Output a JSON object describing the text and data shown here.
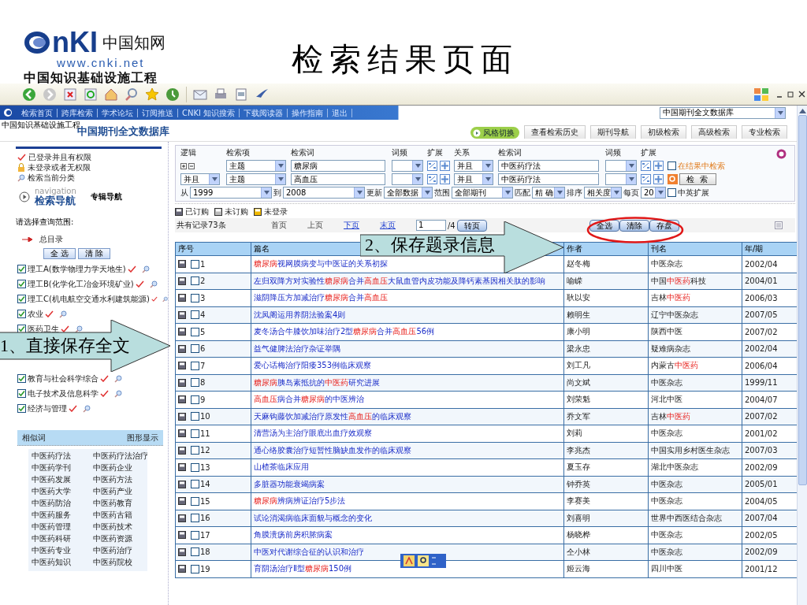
{
  "slide": {
    "title": "检索结果页面",
    "logo": {
      "mark": "nKI",
      "name": "中国知网",
      "url": "www.cnki.net",
      "tagline": "中国知识基础设施工程"
    }
  },
  "site": {
    "logo_tagline": "中国知识基础设施工程",
    "nav": [
      "检索首页",
      "跨库检索",
      "学术论坛",
      "订阅推送",
      "CNKI 知识搜索",
      "下载阅读器",
      "操作指南",
      "退出"
    ],
    "database_select": "中国期刊全文数据库",
    "heading": "中国期刊全文数据库",
    "style_switch": "风格切换",
    "tabs": [
      {
        "label": "查看检索历史",
        "selected": false
      },
      {
        "label": "期刊导航",
        "selected": false
      },
      {
        "label": "初级检索",
        "selected": false
      },
      {
        "label": "高级检索",
        "selected": false
      },
      {
        "label": "专业检索",
        "selected": false
      }
    ]
  },
  "status_legend": [
    {
      "kind": "ok",
      "label": "已登录并且有权限"
    },
    {
      "kind": "lock",
      "label": "未登录或者无权限"
    },
    {
      "kind": "search",
      "label": "检索当前分类"
    }
  ],
  "navigation": {
    "hint": "navigation",
    "label": "检索导航",
    "alt": "专辑导航"
  },
  "scope": {
    "prompt": "请选择查询范围:",
    "root": "总目录",
    "buttons": [
      "全 选",
      "清 除"
    ],
    "categories": [
      {
        "label": "理工A(数学物理力学天地生)",
        "checked": true
      },
      {
        "label": "理工B(化学化工冶金环境矿业)",
        "checked": true
      },
      {
        "label": "理工C(机电航空交通水利建筑能源)",
        "checked": true
      },
      {
        "label": "农业",
        "checked": true
      },
      {
        "label": "医药卫生",
        "checked": true
      },
      {
        "label": "教育与社会科学综合",
        "checked": true
      },
      {
        "label": "电子技术及信息科学",
        "checked": true
      },
      {
        "label": "经济与管理",
        "checked": true
      }
    ]
  },
  "similar": {
    "title": "相似词",
    "action": "图形显示",
    "words": [
      "中医药疗法",
      "中医药疗法治疗",
      "中医药学刊",
      "中医药企业",
      "中医药发展",
      "中医药方法",
      "中医药大学",
      "中医药产业",
      "中医药防治",
      "中医药教育",
      "中医药服务",
      "中医药古籍",
      "中医药管理",
      "中医药技术",
      "中医药科研",
      "中医药资源",
      "中医药专业",
      "中医药治疗",
      "中医药知识",
      "中医药院校"
    ]
  },
  "search": {
    "headers": [
      "逻辑",
      "检索项",
      "检索词",
      "词频",
      "扩展",
      "关系",
      "检索词",
      "词频",
      "扩展"
    ],
    "rows": [
      {
        "field": "主题",
        "term": "糖尿病",
        "relation": "并且",
        "term2": "中医药疗法"
      },
      {
        "logic": "并且",
        "field": "主题",
        "term": "高血压",
        "relation": "并且",
        "term2": "中医药疗法"
      }
    ],
    "options": [
      {
        "label": "从",
        "value": "1999"
      },
      {
        "label": "到",
        "value": "2008"
      },
      {
        "label": "更新",
        "value": "全部数据"
      },
      {
        "label": "范围",
        "value": "全部期刊"
      },
      {
        "label": "匹配",
        "value": "精 确"
      },
      {
        "label": "排序",
        "value": "相关度"
      },
      {
        "label": "每页",
        "value": "20"
      }
    ],
    "bilingual": {
      "label": "中英扩展",
      "checked": false
    },
    "within_results": {
      "label": "在结果中检索",
      "checked": false
    },
    "submit": "检 索"
  },
  "access_legend": [
    {
      "kind": "ordered",
      "label": "已订购"
    },
    {
      "kind": "unordered",
      "label": "未订购"
    },
    {
      "kind": "guest",
      "label": "未登录"
    }
  ],
  "pager": {
    "total": "共有记录73条",
    "links": [
      {
        "label": "首页",
        "enabled": false
      },
      {
        "label": "上页",
        "enabled": false
      },
      {
        "label": "下页",
        "enabled": true
      },
      {
        "label": "末页",
        "enabled": true
      }
    ],
    "page": "1",
    "of": "/4",
    "go": "转页"
  },
  "actions": [
    "全选",
    "清除",
    "存盘"
  ],
  "table": {
    "columns": [
      "序号",
      "篇名",
      "作者",
      "刊名",
      "年/期"
    ],
    "rows": [
      {
        "no": "1",
        "checked": false,
        "title": [
          {
            "text": "糖尿病",
            "hl": true
          },
          {
            "text": "视网膜病变与中医证的关系初探",
            "hl": false
          }
        ],
        "author": "赵冬梅",
        "journal": [
          {
            "text": "中医杂志",
            "hl": false
          }
        ],
        "issue": "2002/04"
      },
      {
        "no": "2",
        "checked": false,
        "title": [
          {
            "text": "左归双降方对实验性",
            "hl": false
          },
          {
            "text": "糖尿病",
            "hl": true
          },
          {
            "text": "合并",
            "hl": false
          },
          {
            "text": "高血压",
            "hl": true
          },
          {
            "text": "大鼠血管内皮功能及降钙素基因相关肽的影响",
            "hl": false
          }
        ],
        "author": "喻嵘",
        "journal": [
          {
            "text": "中国",
            "hl": false
          },
          {
            "text": "中医药",
            "hl": true
          },
          {
            "text": "科技",
            "hl": false
          }
        ],
        "issue": "2004/01"
      },
      {
        "no": "3",
        "checked": false,
        "title": [
          {
            "text": "滋阴降压方加减治疗",
            "hl": false
          },
          {
            "text": "糖尿病",
            "hl": true
          },
          {
            "text": "合并",
            "hl": false
          },
          {
            "text": "高血压",
            "hl": true
          }
        ],
        "author": "耿以安",
        "journal": [
          {
            "text": "吉林",
            "hl": false
          },
          {
            "text": "中医药",
            "hl": true
          }
        ],
        "issue": "2006/03"
      },
      {
        "no": "4",
        "checked": false,
        "title": [
          {
            "text": "沈凤阁运用养阴法验案4则",
            "hl": false
          }
        ],
        "author": "赖明生",
        "journal": [
          {
            "text": "辽宁中医杂志",
            "hl": false
          }
        ],
        "issue": "2007/05"
      },
      {
        "no": "5",
        "checked": false,
        "title": [
          {
            "text": "麦冬汤合牛膝饮加味治疗2型",
            "hl": false
          },
          {
            "text": "糖尿病",
            "hl": true
          },
          {
            "text": "合并",
            "hl": false
          },
          {
            "text": "高血压",
            "hl": true
          },
          {
            "text": "56例",
            "hl": false
          }
        ],
        "author": "康小明",
        "journal": [
          {
            "text": "陕西中医",
            "hl": false
          }
        ],
        "issue": "2007/02"
      },
      {
        "no": "6",
        "checked": false,
        "title": [
          {
            "text": "益气健脾法治疗杂证举隅",
            "hl": false
          }
        ],
        "author": "梁永忠",
        "journal": [
          {
            "text": "疑难病杂志",
            "hl": false
          }
        ],
        "issue": "2002/04"
      },
      {
        "no": "7",
        "checked": false,
        "title": [
          {
            "text": "爱心话梅治疗阳痿353例临床观察",
            "hl": false
          }
        ],
        "author": "刘工凡",
        "journal": [
          {
            "text": "内蒙古",
            "hl": false
          },
          {
            "text": "中医药",
            "hl": true
          }
        ],
        "issue": "2006/04"
      },
      {
        "no": "8",
        "checked": false,
        "title": [
          {
            "text": "糖尿病",
            "hl": true
          },
          {
            "text": "胰岛素抵抗的",
            "hl": false
          },
          {
            "text": "中医药",
            "hl": true
          },
          {
            "text": "研究进展",
            "hl": false
          }
        ],
        "author": "尚文斌",
        "journal": [
          {
            "text": "中医杂志",
            "hl": false
          }
        ],
        "issue": "1999/11"
      },
      {
        "no": "9",
        "checked": false,
        "title": [
          {
            "text": "高血压",
            "hl": true
          },
          {
            "text": "病合并",
            "hl": false
          },
          {
            "text": "糖尿病",
            "hl": true
          },
          {
            "text": "的中医辨治",
            "hl": false
          }
        ],
        "author": "刘荣魁",
        "journal": [
          {
            "text": "河北中医",
            "hl": false
          }
        ],
        "issue": "2004/07"
      },
      {
        "no": "10",
        "checked": false,
        "title": [
          {
            "text": "天麻钩藤饮加减治疗原发性",
            "hl": false
          },
          {
            "text": "高血压",
            "hl": true
          },
          {
            "text": "的临床观察",
            "hl": false
          }
        ],
        "author": "乔文军",
        "journal": [
          {
            "text": "吉林",
            "hl": false
          },
          {
            "text": "中医药",
            "hl": true
          }
        ],
        "issue": "2007/02"
      },
      {
        "no": "11",
        "checked": false,
        "title": [
          {
            "text": "清营汤为主治疗眼底出血疗效观察",
            "hl": false
          }
        ],
        "author": "刘莉",
        "journal": [
          {
            "text": "中医杂志",
            "hl": false
          }
        ],
        "issue": "2001/02"
      },
      {
        "no": "12",
        "checked": false,
        "title": [
          {
            "text": "通心络胶囊治疗短暂性脑缺血发作的临床观察",
            "hl": false
          }
        ],
        "author": "李兆杰",
        "journal": [
          {
            "text": "中国实用乡村医生杂志",
            "hl": false
          }
        ],
        "issue": "2007/03"
      },
      {
        "no": "13",
        "checked": false,
        "title": [
          {
            "text": "山楂茶临床应用",
            "hl": false
          }
        ],
        "author": "夏玉存",
        "journal": [
          {
            "text": "湖北中医杂志",
            "hl": false
          }
        ],
        "issue": "2002/09"
      },
      {
        "no": "14",
        "checked": false,
        "title": [
          {
            "text": "多脏器功能衰竭病案",
            "hl": false
          }
        ],
        "author": "钟乔英",
        "journal": [
          {
            "text": "中医杂志",
            "hl": false
          }
        ],
        "issue": "2005/01"
      },
      {
        "no": "15",
        "checked": false,
        "title": [
          {
            "text": "糖尿病",
            "hl": true
          },
          {
            "text": "辨病辨证治疗5步法",
            "hl": false
          }
        ],
        "author": "李赛美",
        "journal": [
          {
            "text": "中医杂志",
            "hl": false
          }
        ],
        "issue": "2004/05"
      },
      {
        "no": "16",
        "checked": false,
        "title": [
          {
            "text": "试论消渴病临床面貌与概念的变化",
            "hl": false
          }
        ],
        "author": "刘喜明",
        "journal": [
          {
            "text": "世界中西医结合杂志",
            "hl": false
          }
        ],
        "issue": "2007/04"
      },
      {
        "no": "17",
        "checked": false,
        "title": [
          {
            "text": "角膜溃疡前房积脓病案",
            "hl": false
          }
        ],
        "author": "杨晓桦",
        "journal": [
          {
            "text": "中医杂志",
            "hl": false
          }
        ],
        "issue": "2002/05"
      },
      {
        "no": "18",
        "checked": false,
        "title": [
          {
            "text": "中医对代谢综合征的认识和治疗",
            "hl": false
          }
        ],
        "author": "仝小林",
        "journal": [
          {
            "text": "中医杂志",
            "hl": false
          }
        ],
        "issue": "2002/09"
      },
      {
        "no": "19",
        "checked": false,
        "title": [
          {
            "text": "育阴汤治疗Ⅱ型",
            "hl": false
          },
          {
            "text": "糖尿病",
            "hl": true
          },
          {
            "text": "150例",
            "hl": false
          }
        ],
        "author": "姬云海",
        "journal": [
          {
            "text": "四川中医",
            "hl": false
          }
        ],
        "issue": "2001/12"
      }
    ]
  },
  "callouts": [
    {
      "label": "1、直接保存全文"
    },
    {
      "label": "2、保存题录信息"
    }
  ]
}
